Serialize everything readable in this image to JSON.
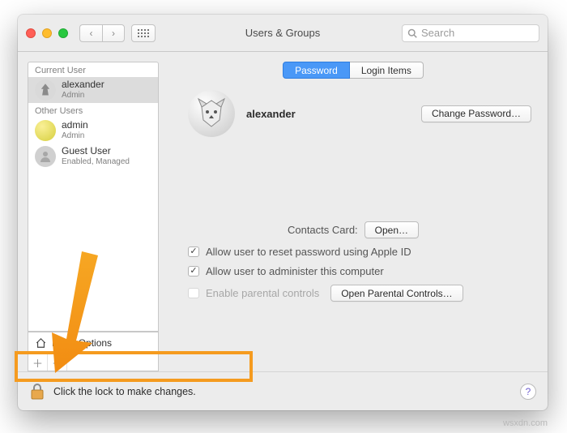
{
  "window": {
    "title": "Users & Groups"
  },
  "search": {
    "placeholder": "Search"
  },
  "sidebar": {
    "current_label": "Current User",
    "other_label": "Other Users",
    "current": {
      "name": "alexander",
      "role": "Admin"
    },
    "others": [
      {
        "name": "admin",
        "role": "Admin"
      },
      {
        "name": "Guest User",
        "role": "Enabled, Managed"
      }
    ],
    "login_options": "Login Options"
  },
  "tabs": {
    "password": "Password",
    "login_items": "Login Items"
  },
  "profile": {
    "name": "alexander",
    "change_password": "Change Password…"
  },
  "contacts": {
    "label": "Contacts Card:",
    "open": "Open…"
  },
  "checks": {
    "reset_apple_id": "Allow user to reset password using Apple ID",
    "administer": "Allow user to administer this computer",
    "parental": "Enable parental controls",
    "parental_btn": "Open Parental Controls…"
  },
  "footer": {
    "lock_text": "Click the lock to make changes."
  },
  "watermark": "wsxdn.com"
}
